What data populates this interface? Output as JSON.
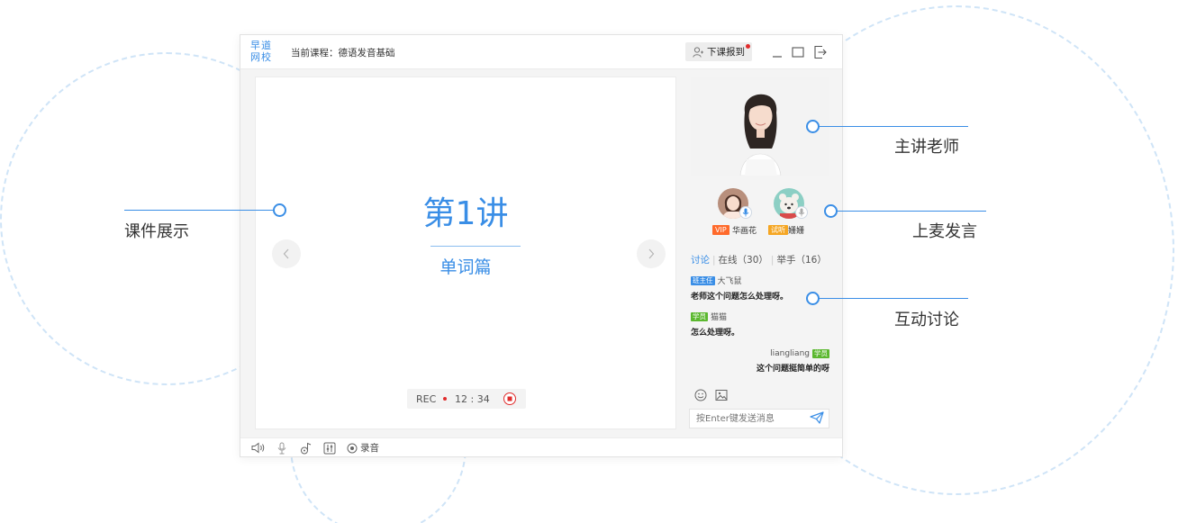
{
  "window": {
    "logo_line1": "早道",
    "logo_line2": "网校",
    "course_label": "当前课程：德语发音基础",
    "checkin_label": "下课报到"
  },
  "slide": {
    "title": "第1讲",
    "subtitle": "单词篇",
    "rec_label": "REC",
    "rec_time": "12 : 34"
  },
  "speakers": [
    {
      "tag": "VIP",
      "name": "华画花"
    },
    {
      "tag": "试听",
      "name": "姗姗"
    }
  ],
  "chat": {
    "tab_discuss": "讨论",
    "tab_online": "在线（30）",
    "tab_hands": "举手（16）",
    "messages": [
      {
        "badge": "班主任",
        "user": "大飞鼠",
        "text": "老师这个问题怎么处理呀。"
      },
      {
        "badge": "学员",
        "user": "猫猫",
        "text": "怎么处理呀。"
      },
      {
        "badge": "学员",
        "user": "liangliang",
        "text": "这个问题挺简单的呀"
      }
    ],
    "input_placeholder": "按Enter键发送消息"
  },
  "toolbar": {
    "record_label": "录音"
  },
  "callouts": {
    "courseware": "课件展示",
    "teacher": "主讲老师",
    "mic": "上麦发言",
    "discussion": "互动讨论"
  },
  "colors": {
    "accent": "#3a8ee6",
    "vip": "#ff6a2b",
    "trial": "#f5a623",
    "student": "#5bb82f",
    "rec_dot": "#e02b2b"
  }
}
